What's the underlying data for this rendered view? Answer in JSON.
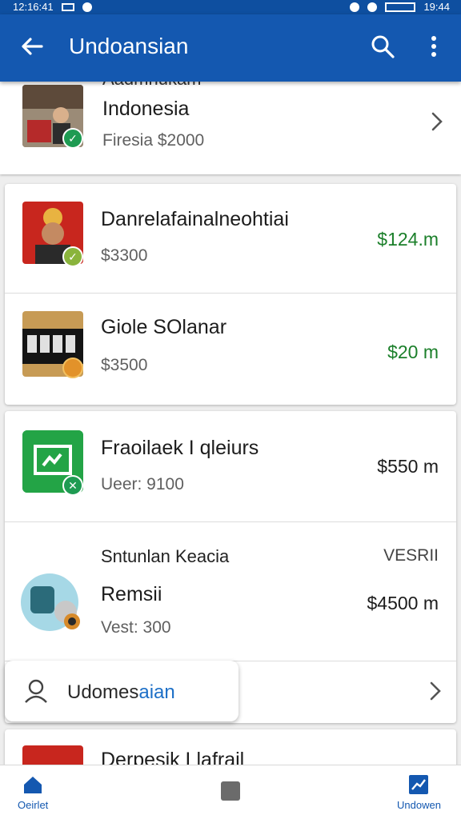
{
  "status_bar": {
    "time_left": "12:16:41",
    "time_right": "19:44"
  },
  "app_bar": {
    "title": "Undoansian"
  },
  "top_item": {
    "overflow_text": "Aadmnukam",
    "name": "Indonesia",
    "sub": "Firesia $2000"
  },
  "group1": [
    {
      "name": "Danrelafainalneohtiai",
      "sub": "$3300",
      "price": "$124.m",
      "price_color": "#1b7f2a"
    },
    {
      "name": "Giole SOlanar",
      "sub": "$3500",
      "price": "$20 m",
      "price_color": "#1b7f2a"
    }
  ],
  "group2": [
    {
      "name": "Fraoilaek I qleiurs",
      "sub": "Ueer: 9100",
      "price": "$550 m"
    },
    {
      "overline": "Sntunlan Keacia",
      "tag": "VESRII",
      "name": "Remsii",
      "sub": "Vest: 300",
      "price": "$4500 m"
    }
  ],
  "search_pill": {
    "label_a": "Udomes",
    "label_b": "aian"
  },
  "partial_item": {
    "name": "Derpesik Llafrail"
  },
  "bottom_nav": [
    {
      "label": "Oeirlet",
      "icon": "home-icon"
    },
    {
      "label": "",
      "icon": "square-icon"
    },
    {
      "label": "Undowen",
      "icon": "chart-icon"
    }
  ],
  "colors": {
    "primary": "#1458b0",
    "price_green": "#1b7f2a",
    "accent": "#1c6fc7"
  }
}
